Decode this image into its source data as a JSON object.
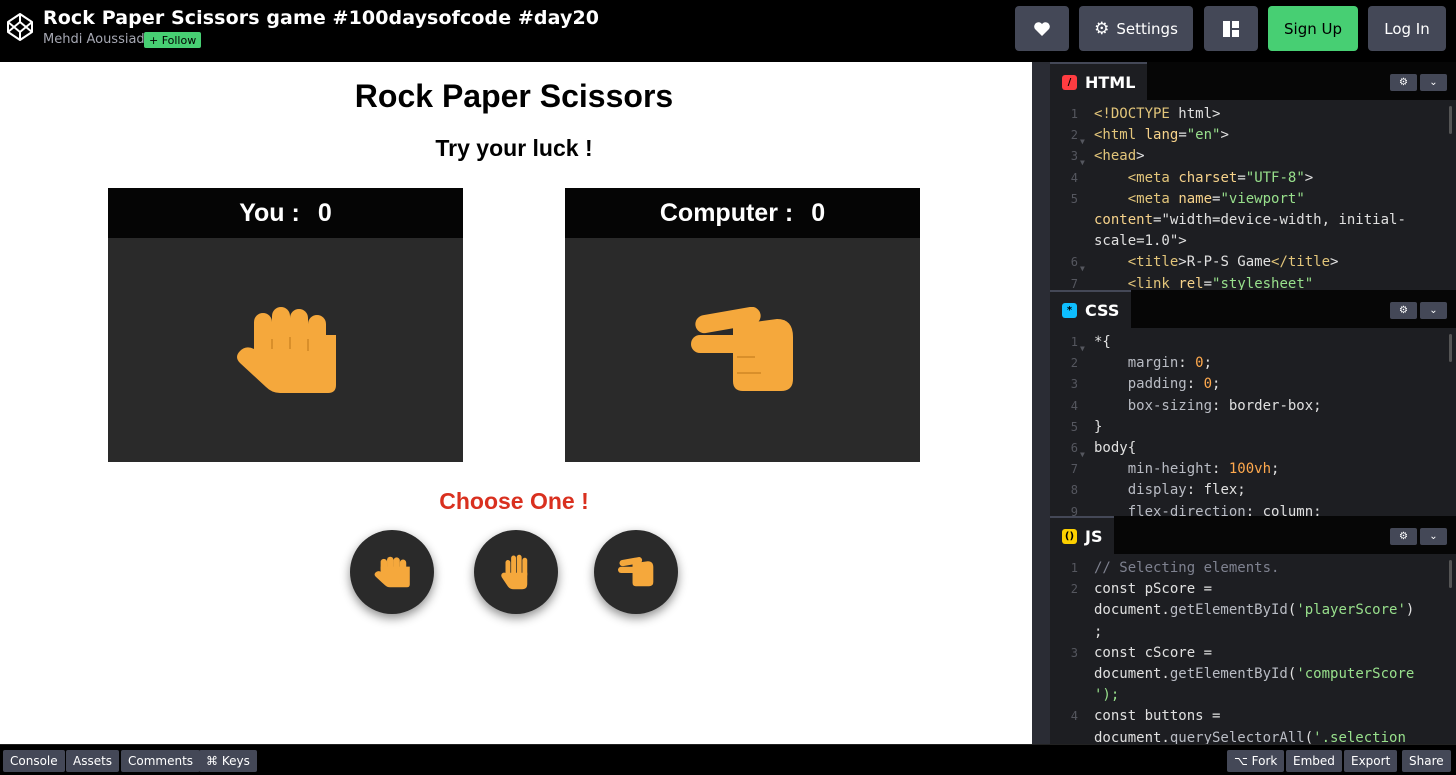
{
  "header": {
    "title": "Rock Paper Scissors game #100daysofcode #day20",
    "author": "Mehdi Aoussiad",
    "follow_label": "+ Follow",
    "settings_label": "Settings",
    "signup_label": "Sign Up",
    "login_label": "Log In",
    "icons": [
      "codepen-logo-icon",
      "heart-icon",
      "gear-icon",
      "layout-icon"
    ]
  },
  "game": {
    "title": "Rock Paper Scissors",
    "subtitle": "Try your luck !",
    "player_label": "You :",
    "player_score": "0",
    "computer_label": "Computer :",
    "computer_score": "0",
    "choose_label": "Choose One !",
    "player_hand": "rock-hand-icon",
    "computer_hand": "scissors-hand-icon",
    "choices": [
      "rock-hand-icon",
      "paper-hand-icon",
      "scissors-hand-icon"
    ],
    "accent_color": "#f5a83c",
    "choose_color": "#d9301f"
  },
  "editors": {
    "html": {
      "label": "HTML",
      "lines": [
        {
          "n": "1",
          "t": "<!DOCTYPE html>"
        },
        {
          "n": "2",
          "t": "<html lang=\"en\">"
        },
        {
          "n": "3",
          "t": "<head>"
        },
        {
          "n": "4",
          "t": "    <meta charset=\"UTF-8\">"
        },
        {
          "n": "5",
          "t": "    <meta name=\"viewport\""
        },
        {
          "n": "",
          "t": "content=\"width=device-width, initial-"
        },
        {
          "n": "",
          "t": "scale=1.0\">"
        },
        {
          "n": "6",
          "t": "    <title>R-P-S Game</title>"
        },
        {
          "n": "7",
          "t": "    <link rel=\"stylesheet\""
        }
      ]
    },
    "css": {
      "label": "CSS",
      "lines": [
        {
          "n": "1",
          "t": "*{"
        },
        {
          "n": "2",
          "t": "    margin: 0;"
        },
        {
          "n": "3",
          "t": "    padding: 0;"
        },
        {
          "n": "4",
          "t": "    box-sizing: border-box;"
        },
        {
          "n": "5",
          "t": "}"
        },
        {
          "n": "6",
          "t": "body{"
        },
        {
          "n": "7",
          "t": "    min-height: 100vh;"
        },
        {
          "n": "8",
          "t": "    display: flex;"
        },
        {
          "n": "9",
          "t": "    flex-direction: column;"
        }
      ]
    },
    "js": {
      "label": "JS",
      "lines": [
        {
          "n": "1",
          "t": "// Selecting elements."
        },
        {
          "n": "2",
          "t": "const pScore ="
        },
        {
          "n": "",
          "t": "document.getElementById('playerScore')"
        },
        {
          "n": "",
          "t": ";"
        },
        {
          "n": "3",
          "t": "const cScore ="
        },
        {
          "n": "",
          "t": "document.getElementById('computerScore"
        },
        {
          "n": "",
          "t": "');"
        },
        {
          "n": "4",
          "t": "const buttons ="
        },
        {
          "n": "",
          "t": "document.querySelectorAll('.selection"
        }
      ]
    }
  },
  "footer": {
    "left": [
      "Console",
      "Assets",
      "Comments",
      "⌘ Keys"
    ],
    "right": [
      "⌥ Fork",
      "Embed",
      "Export",
      "Share"
    ]
  }
}
